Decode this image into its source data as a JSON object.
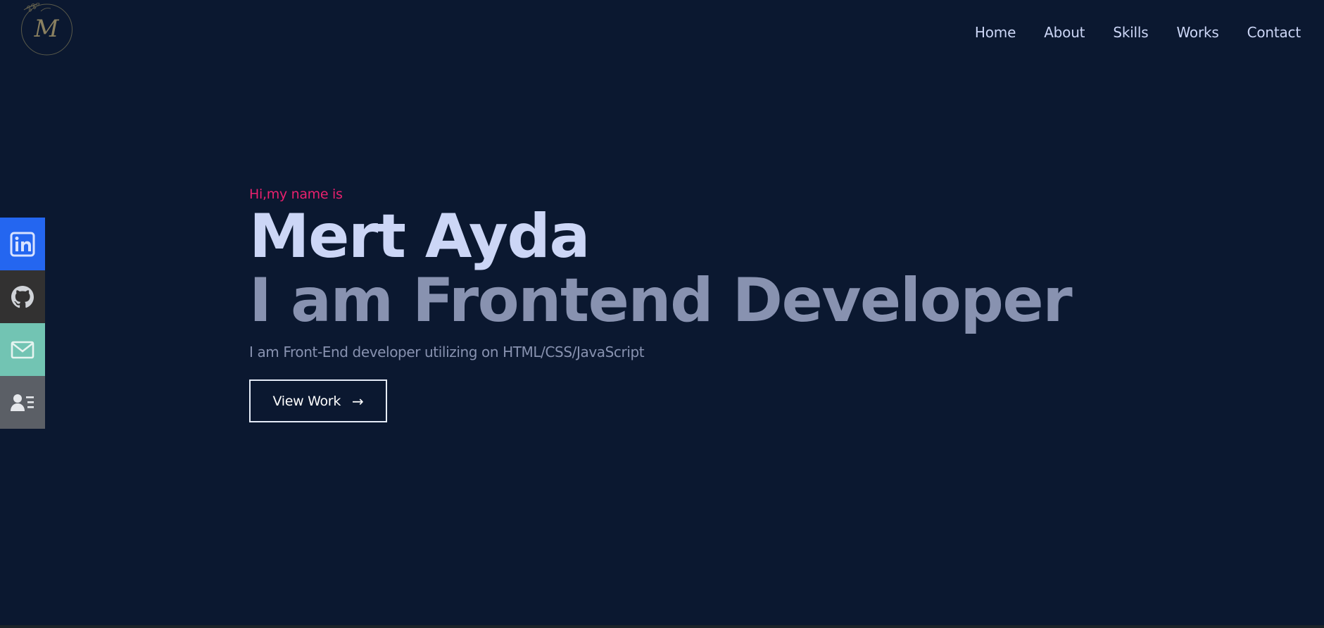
{
  "nav": {
    "items": [
      {
        "label": "Home"
      },
      {
        "label": "About"
      },
      {
        "label": "Skills"
      },
      {
        "label": "Works"
      },
      {
        "label": "Contact"
      }
    ]
  },
  "social": {
    "icons": [
      "linkedin-icon",
      "github-icon",
      "mail-icon",
      "cv-icon"
    ]
  },
  "hero": {
    "greeting": "Hi,my name is",
    "name": "Mert Ayda",
    "role": "I am Frontend Developer",
    "description": "I am Front-End developer utilizing on HTML/CSS/JavaScript",
    "button_label": "View Work",
    "button_arrow": "→"
  },
  "logo": {
    "letter": "M"
  },
  "colors": {
    "background": "#0b1830",
    "accent": "#e8216e",
    "heading": "#ccd6f6",
    "muted": "#8892b0",
    "linkedin": "#2466f0",
    "github": "#323131",
    "mail": "#72c4b3",
    "cv": "#5b5f66"
  }
}
